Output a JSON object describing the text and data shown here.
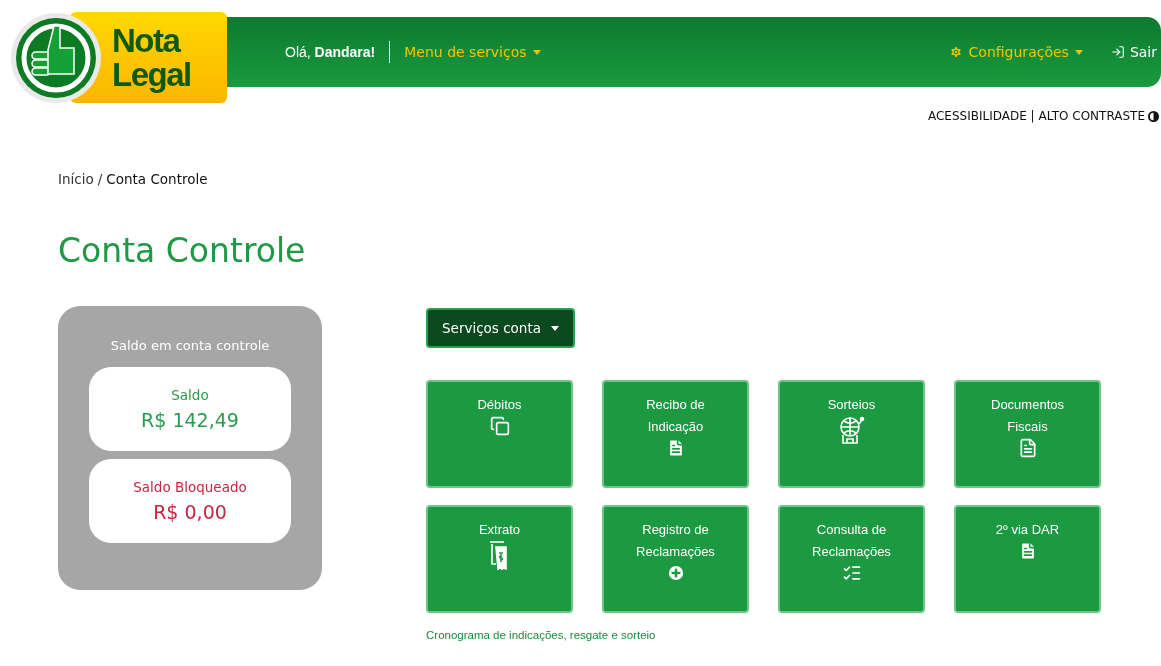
{
  "logo": {
    "line_1": "Nota",
    "line_2": "Legal"
  },
  "header": {
    "greeting": "Olá,",
    "user": "Dandara!",
    "menu": "Menu de serviços",
    "settings": "Configurações",
    "logout": "Sair"
  },
  "accessibility": {
    "label": "ACESSIBILIDADE | ALTO CONTRASTE"
  },
  "breadcrumb": {
    "home": "Início",
    "separator": "/",
    "current": "Conta Controle"
  },
  "page_title": "Conta Controle",
  "balance_panel": {
    "title": "Saldo em conta controle",
    "items": [
      {
        "kind": "positive",
        "label": "Saldo",
        "value": "R$ 142,49"
      },
      {
        "kind": "blocked",
        "label": "Saldo Bloqueado",
        "value": "R$ 0,00"
      }
    ]
  },
  "services_button": "Serviços conta",
  "tiles": [
    {
      "kind": "copy",
      "label_lines": [
        "Débitos"
      ]
    },
    {
      "kind": "file",
      "label_lines": [
        "Recibo de",
        "Indicação"
      ]
    },
    {
      "kind": "lottery",
      "label_lines": [
        "Sorteios"
      ]
    },
    {
      "kind": "file-outline",
      "label_lines": [
        "Documentos",
        "Fiscais"
      ]
    },
    {
      "kind": "receipt",
      "label_lines": [
        "Extrato"
      ]
    },
    {
      "kind": "plus",
      "label_lines": [
        "Registro de",
        "Reclamações"
      ]
    },
    {
      "kind": "checklist",
      "label_lines": [
        "Consulta de",
        "Reclamações"
      ]
    },
    {
      "kind": "file",
      "label_lines": [
        "2º via DAR"
      ]
    }
  ],
  "schedule_link": "Cronograma de indicações, resgate e sorteio"
}
